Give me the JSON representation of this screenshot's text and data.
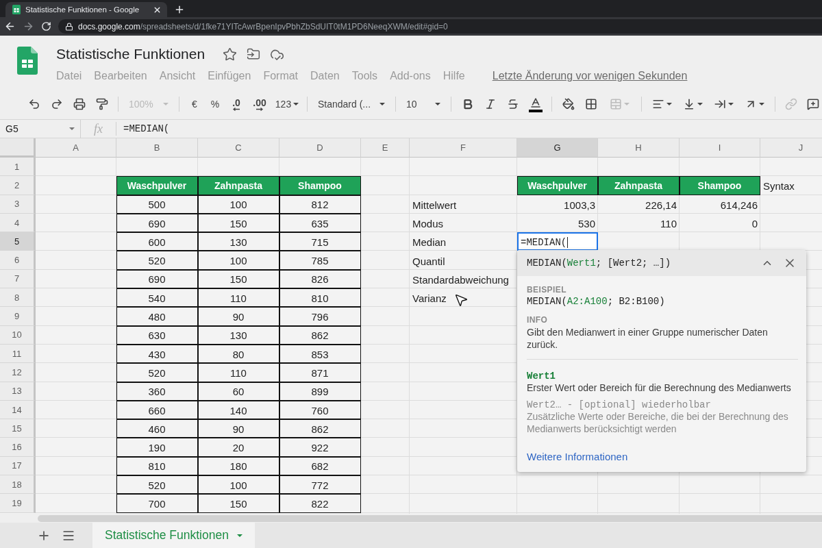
{
  "browser": {
    "tab": {
      "title": "Statistische Funktionen - Google",
      "selected": true
    },
    "address": {
      "host": "docs.google.com",
      "path": "/spreadsheets/d/1fke71YITcAwrBpenIpvPbhZbSdUIT0tM1PD6NeeqXWM/edit#gid=0"
    }
  },
  "document": {
    "title": "Statistische Funktionen",
    "starred": false,
    "menu": [
      "Datei",
      "Bearbeiten",
      "Ansicht",
      "Einfügen",
      "Format",
      "Daten",
      "Tools",
      "Add-ons",
      "Hilfe"
    ],
    "last_edit": "Letzte Änderung vor wenigen Sekunden"
  },
  "toolbar": {
    "zoom": {
      "value": "100%",
      "disabled": true
    },
    "currency": "€",
    "percent": "%",
    "decimals_less": ".0",
    "decimals_more": ".00",
    "number_format": "123",
    "font": "Standard (...",
    "font_size": "10",
    "merge": {
      "disabled": true
    },
    "link": {
      "disabled": true
    }
  },
  "formula_bar": {
    "cell_ref": "G5",
    "label": "fx",
    "formula": "=MEDIAN("
  },
  "sheet": {
    "columns": [
      {
        "label": "A",
        "selected": false
      },
      {
        "label": "B",
        "selected": false
      },
      {
        "label": "C",
        "selected": false
      },
      {
        "label": "D",
        "selected": false
      },
      {
        "label": "E",
        "selected": false
      },
      {
        "label": "F",
        "selected": false
      },
      {
        "label": "G",
        "selected": true
      },
      {
        "label": "H",
        "selected": false
      },
      {
        "label": "I",
        "selected": false
      },
      {
        "label": "J",
        "selected": false
      }
    ],
    "rows": [
      {
        "label": "1",
        "selected": false
      },
      {
        "label": "2",
        "selected": false
      },
      {
        "label": "3",
        "selected": false
      },
      {
        "label": "4",
        "selected": false
      },
      {
        "label": "5",
        "selected": true
      },
      {
        "label": "6",
        "selected": false
      },
      {
        "label": "7",
        "selected": false
      },
      {
        "label": "8",
        "selected": false
      },
      {
        "label": "9",
        "selected": false
      },
      {
        "label": "10",
        "selected": false
      },
      {
        "label": "11",
        "selected": false
      },
      {
        "label": "12",
        "selected": false
      },
      {
        "label": "13",
        "selected": false
      },
      {
        "label": "14",
        "selected": false
      },
      {
        "label": "15",
        "selected": false
      },
      {
        "label": "16",
        "selected": false
      },
      {
        "label": "17",
        "selected": false
      },
      {
        "label": "18",
        "selected": false
      },
      {
        "label": "19",
        "selected": false
      }
    ]
  },
  "product_table": {
    "headers": [
      "Waschpulver",
      "Zahnpasta",
      "Shampoo"
    ],
    "rows": [
      [
        "500",
        "100",
        "812"
      ],
      [
        "690",
        "150",
        "635"
      ],
      [
        "600",
        "130",
        "715"
      ],
      [
        "520",
        "100",
        "785"
      ],
      [
        "690",
        "150",
        "826"
      ],
      [
        "540",
        "110",
        "810"
      ],
      [
        "480",
        "90",
        "796"
      ],
      [
        "630",
        "130",
        "862"
      ],
      [
        "430",
        "80",
        "853"
      ],
      [
        "520",
        "110",
        "871"
      ],
      [
        "360",
        "60",
        "899"
      ],
      [
        "660",
        "140",
        "760"
      ],
      [
        "460",
        "90",
        "862"
      ],
      [
        "190",
        "20",
        "922"
      ],
      [
        "810",
        "180",
        "682"
      ],
      [
        "520",
        "100",
        "772"
      ],
      [
        "700",
        "150",
        "822"
      ]
    ]
  },
  "statistics": {
    "labels": [
      "Mittelwert",
      "Modus",
      "Median",
      "Quantil",
      "Standardabweichung",
      "Varianz"
    ],
    "headers": [
      "Waschpulver",
      "Zahnpasta",
      "Shampoo"
    ],
    "rows": [
      [
        "1003,3",
        "226,14",
        "614,246"
      ],
      [
        "530",
        "110",
        "0"
      ]
    ],
    "editing_cell": {
      "value": "=MEDIAN("
    },
    "note": "Syntax"
  },
  "formula_help": {
    "expanded": true,
    "syntax": [
      {
        "text": "MEDIAN(",
        "highlight": false
      },
      {
        "text": "Wert1",
        "highlight": true
      },
      {
        "text": "; [Wert2; …])",
        "highlight": false
      }
    ],
    "example_label": "BEISPIEL",
    "example": [
      {
        "text": "MEDIAN(",
        "highlight": false
      },
      {
        "text": "A2:A100",
        "highlight": true
      },
      {
        "text": "; B2:B100)",
        "highlight": false
      }
    ],
    "info_label": "INFO",
    "info": "Gibt den Medianwert in einer Gruppe numerischer Daten zurück.",
    "arguments": [
      {
        "name": "Wert1",
        "description": "Erster Wert oder Bereich für die Berechnung des Medianwerts",
        "current": true
      },
      {
        "name": "Wert2… - [optional] wiederholbar",
        "description": "Zusätzliche Werte oder Bereiche, die bei der Berechnung des Medianwerts berücksichtigt werden",
        "current": false
      }
    ],
    "link": "Weitere Informationen"
  },
  "sheet_tabs": [
    {
      "label": "Statistische Funktionen",
      "selected": true
    }
  ]
}
